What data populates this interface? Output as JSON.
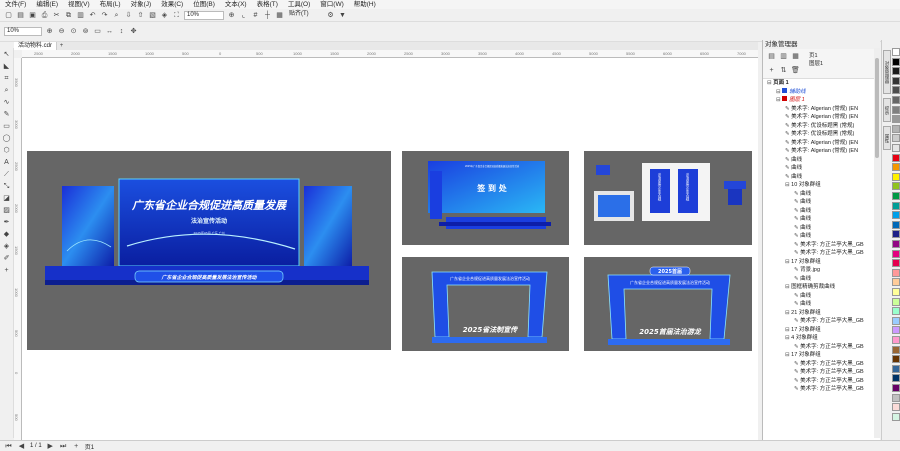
{
  "menu": [
    "文件(F)",
    "编辑(E)",
    "视图(V)",
    "布局(L)",
    "对象(J)",
    "效果(C)",
    "位图(B)",
    "文本(X)",
    "表格(T)",
    "工具(O)",
    "窗口(W)",
    "帮助(H)"
  ],
  "toolbar1": {
    "zoom": "10%",
    "snap_label": "贴齐(T)"
  },
  "toolbar2": {
    "zoom": "10%"
  },
  "doc_tab": "活动物料.cdr",
  "ruler_h": [
    "2500",
    "2000",
    "1500",
    "1000",
    "500",
    "0",
    "500",
    "1000",
    "1500",
    "2000",
    "2500",
    "3000",
    "3500",
    "4000",
    "4500",
    "5000",
    "5500",
    "6000",
    "6500",
    "7000"
  ],
  "ruler_v": [
    "3500",
    "3000",
    "2500",
    "2000",
    "1500",
    "1000",
    "500",
    "0",
    "500"
  ],
  "artwork": {
    "stage_title": "广东省企业合规促进高质量发展",
    "stage_subtitle": "法治宣传活动",
    "stage_info": "2025年05月 广东 广州",
    "stage_front": "广东省企业合规促高质量发展法治宣传活动",
    "signin": "签 到 处",
    "signin_header": "2025年广东省企业合规促进高质量发展法治宣传活动",
    "arch1_top": "广东省企业合规促进高质量发展法治宣传活动",
    "arch1_bottom": "2025省法制宣传",
    "arch2_top": "广东省企业合规促进高质量发展法治宣传活动",
    "arch2_badge": "2025首届",
    "arch2_bottom": "2025首届法治游龙",
    "rollup1": "法治宣传企业合规",
    "rollup2": "法治宣传企业合规"
  },
  "status": {
    "page": "1 / 1",
    "page_name": "页1"
  },
  "panel": {
    "title": "对象管理器",
    "page": "页1",
    "layer": "图层1",
    "tree": [
      {
        "t": "页面 1",
        "lv": 0,
        "b": true
      },
      {
        "t": "辅助线",
        "lv": 1,
        "c": "#1f4fd6"
      },
      {
        "t": "图层 1",
        "lv": 1,
        "c": "#d00000"
      },
      {
        "t": "美术字: Algerian (常规) (EN",
        "lv": 2
      },
      {
        "t": "美术字: Algerian (常规) (EN",
        "lv": 2
      },
      {
        "t": "美术字: 优设标题黑 (常规)",
        "lv": 2
      },
      {
        "t": "美术字: 优设标题黑 (常规)",
        "lv": 2
      },
      {
        "t": "美术字: Algerian (常规) (EN",
        "lv": 2
      },
      {
        "t": "美术字: Algerian (常规) (EN",
        "lv": 2
      },
      {
        "t": "曲线",
        "lv": 2
      },
      {
        "t": "曲线",
        "lv": 2
      },
      {
        "t": "曲线",
        "lv": 2
      },
      {
        "t": "10 对象群组",
        "lv": 2,
        "g": true
      },
      {
        "t": "曲线",
        "lv": 3
      },
      {
        "t": "曲线",
        "lv": 3
      },
      {
        "t": "曲线",
        "lv": 3
      },
      {
        "t": "曲线",
        "lv": 3
      },
      {
        "t": "曲线",
        "lv": 3
      },
      {
        "t": "曲线",
        "lv": 3
      },
      {
        "t": "美术字: 方正兰亭大黑_GB",
        "lv": 3
      },
      {
        "t": "美术字: 方正兰亭大黑_GB",
        "lv": 3
      },
      {
        "t": "17 对象群组",
        "lv": 2,
        "g": true
      },
      {
        "t": "背景.jpg",
        "lv": 3
      },
      {
        "t": "曲线",
        "lv": 3
      },
      {
        "t": "图框精确剪裁曲线",
        "lv": 2,
        "g": true
      },
      {
        "t": "曲线",
        "lv": 3
      },
      {
        "t": "曲线",
        "lv": 3
      },
      {
        "t": "21 对象群组",
        "lv": 2,
        "g": true
      },
      {
        "t": "美术字: 方正兰亭大黑_GB",
        "lv": 3
      },
      {
        "t": "17 对象群组",
        "lv": 2,
        "g": true
      },
      {
        "t": "4 对象群组",
        "lv": 2,
        "g": true
      },
      {
        "t": "美术字: 方正兰亭大黑_GB",
        "lv": 3
      },
      {
        "t": "17 对象群组",
        "lv": 2,
        "g": true
      },
      {
        "t": "美术字: 方正兰亭大黑_GB",
        "lv": 3
      },
      {
        "t": "美术字: 方正兰亭大黑_GB",
        "lv": 3
      },
      {
        "t": "美术字: 方正兰亭大黑_GB",
        "lv": 3
      },
      {
        "t": "美术字: 方正兰亭大黑_GB",
        "lv": 3
      }
    ]
  },
  "side_tabs": [
    "对象管理器",
    "提示",
    "属性"
  ],
  "palette": [
    "#ffffff",
    "#000000",
    "#1a1a1a",
    "#333333",
    "#4d4d4d",
    "#666666",
    "#808080",
    "#999999",
    "#b3b3b3",
    "#cccccc",
    "#e6e6e6",
    "#e60012",
    "#f39800",
    "#fff100",
    "#8fc31f",
    "#009944",
    "#009e96",
    "#00a0e9",
    "#0068b7",
    "#1d2088",
    "#920783",
    "#e4007f",
    "#e5004f",
    "#ff9999",
    "#ffcc99",
    "#ffff99",
    "#ccff99",
    "#99ffcc",
    "#99ccff",
    "#cc99ff",
    "#ff99cc",
    "#996633",
    "#663300",
    "#336699",
    "#003366",
    "#660066",
    "#c0c0c0",
    "#fadbd8",
    "#d5f5e3"
  ]
}
